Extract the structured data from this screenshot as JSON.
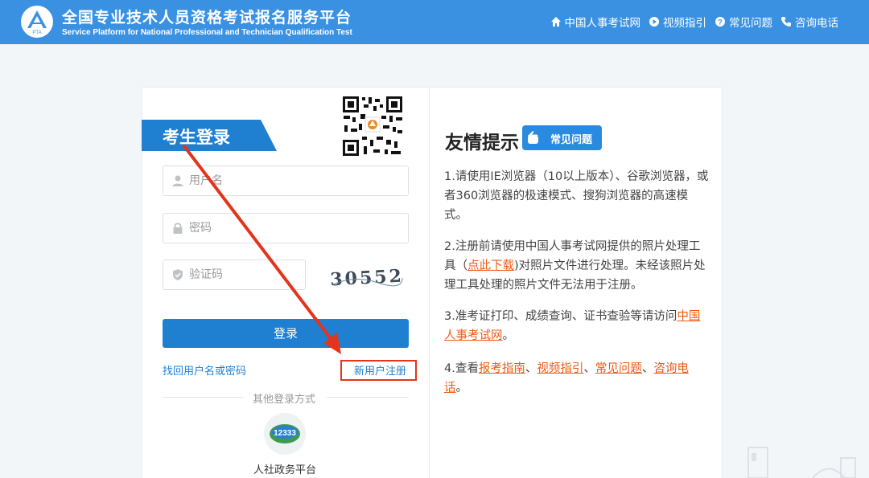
{
  "header": {
    "title": "全国专业技术人员资格考试报名服务平台",
    "subtitle": "Service Platform for National Professional and Technician Qualification Test",
    "logo_text": "PTA",
    "nav": [
      {
        "label": "中国人事考试网",
        "icon": "home-icon"
      },
      {
        "label": "视频指引",
        "icon": "play-icon"
      },
      {
        "label": "常见问题",
        "icon": "question-icon"
      },
      {
        "label": "咨询电话",
        "icon": "phone-icon"
      }
    ]
  },
  "login": {
    "tab_title": "考生登录",
    "username_placeholder": "用户名",
    "password_placeholder": "密码",
    "captcha_placeholder": "验证码",
    "captcha_text": "30552",
    "login_button": "登录",
    "forgot_link": "找回用户名或密码",
    "register_link": "新用户注册",
    "other_methods": "其他登录方式",
    "rsz_label": "人社政务平台",
    "rsz_badge": "12333"
  },
  "tips": {
    "title": "友情提示",
    "faq_badge": "常见问题",
    "tip1": "1.请使用IE浏览器（10以上版本）、谷歌浏览器，或者360浏览器的极速模式、搜狗浏览器的高速模式。",
    "tip2_before": "2.注册前请使用中国人事考试网提供的照片处理工具（",
    "tip2_link": "点此下载",
    "tip2_after": ")对照片文件进行处理。未经该照片处理工具处理的照片文件无法用于注册。",
    "tip3_before": "3.准考证打印、成绩查询、证书查验等请访问",
    "tip3_link": "中国人事考试网",
    "tip3_after": "。",
    "tip4_before": "4.查看",
    "tip4_links": [
      "报考指南",
      "视频指引",
      "常见问题",
      "咨询电话"
    ],
    "tip4_sep": "、",
    "tip4_after": "。"
  },
  "colors": {
    "header_bg": "#3a91e2",
    "primary": "#1f7fd0",
    "link_orange": "#f05a14",
    "annotation_red": "#e3341c"
  }
}
